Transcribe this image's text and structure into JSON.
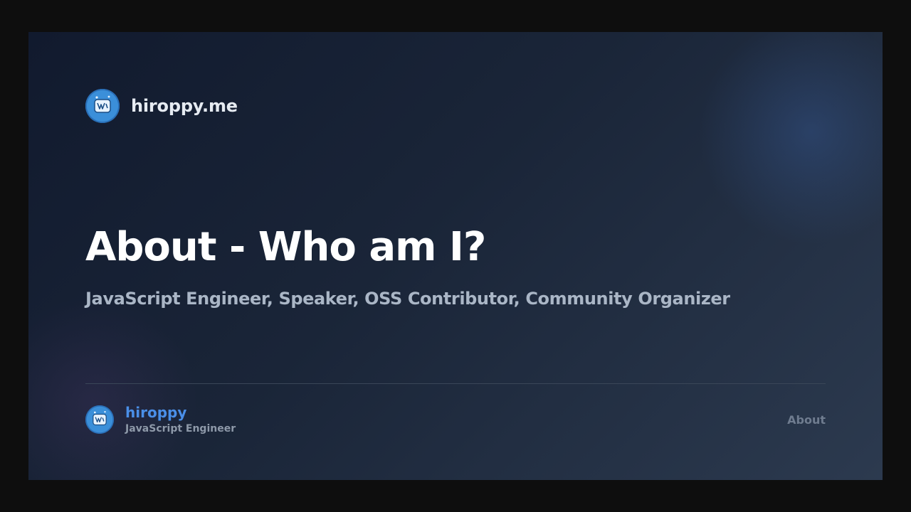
{
  "site": {
    "name": "hiroppy.me",
    "avatar_icon": "avatar-icon"
  },
  "hero": {
    "title": "About - Who am I?",
    "subtitle": "JavaScript Engineer, Speaker, OSS Contributor, Community Organizer"
  },
  "footer": {
    "author_name": "hiroppy",
    "author_role": "JavaScript Engineer",
    "page_tag": "About"
  },
  "colors": {
    "background": "#0e0e0e",
    "card_gradient_start": "#111a2e",
    "card_gradient_end": "#2c3a4f",
    "title": "#ffffff",
    "subtitle": "#aab6c6",
    "accent": "#4a8fe8",
    "muted": "#6f7c8f",
    "avatar": "#3b8fd9"
  }
}
